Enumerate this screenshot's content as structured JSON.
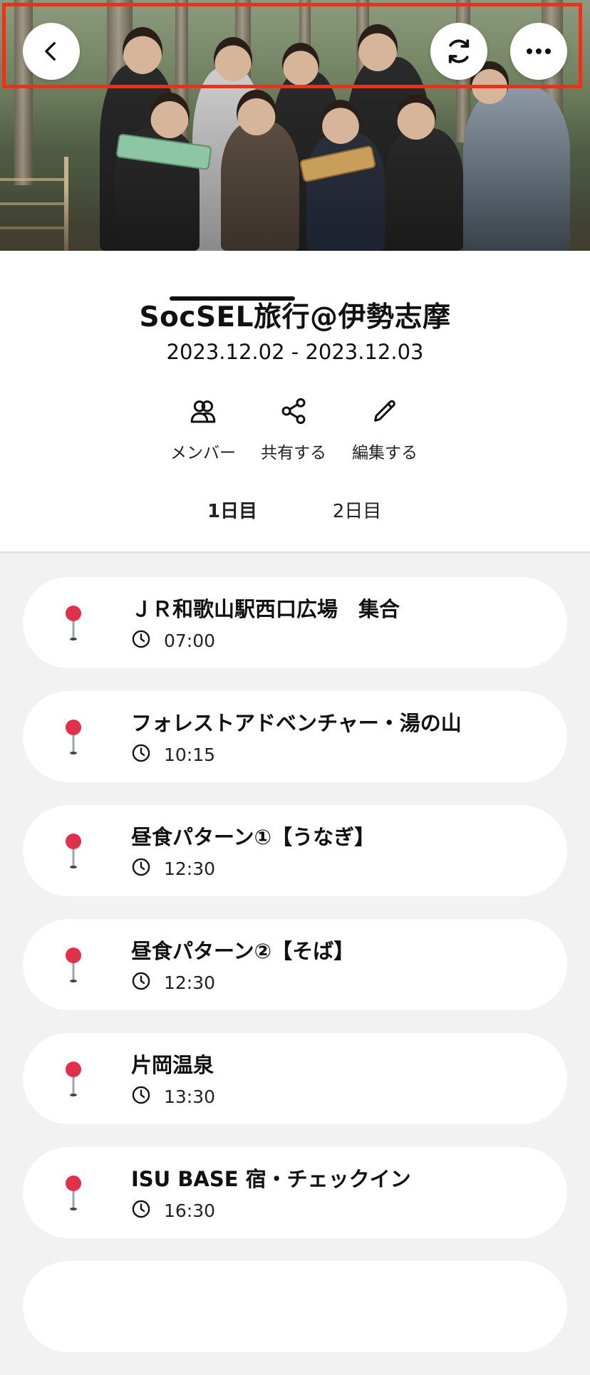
{
  "header": {
    "back_icon": "chevron-left-icon",
    "refresh_icon": "refresh-icon",
    "more_icon": "more-horizontal-icon",
    "highlight_color": "#ff2a12"
  },
  "trip": {
    "title": "SocSEL旅行@伊勢志摩",
    "dates": "2023.12.02 - 2023.12.03"
  },
  "actions": {
    "members_label": "メンバー",
    "share_label": "共有する",
    "edit_label": "編集する"
  },
  "tabs": [
    {
      "label": "1日目",
      "selected": true
    },
    {
      "label": "2日目",
      "selected": false
    }
  ],
  "schedule": [
    {
      "name": "ＪＲ和歌山駅西口広場　集合",
      "time": "07:00"
    },
    {
      "name": "フォレストアドベンチャー・湯の山",
      "time": "10:15"
    },
    {
      "name": "昼食パターン①【うなぎ】",
      "time": "12:30"
    },
    {
      "name": "昼食パターン②【そば】",
      "time": "12:30"
    },
    {
      "name": "片岡温泉",
      "time": "13:30"
    },
    {
      "name": "ISU BASE 宿・チェックイン",
      "time": "16:30"
    }
  ],
  "colors": {
    "pin_head": "#e0304a",
    "pin_stem": "#9aa7b0",
    "card_bg": "#ffffff",
    "page_bg": "#f2f2f2"
  }
}
